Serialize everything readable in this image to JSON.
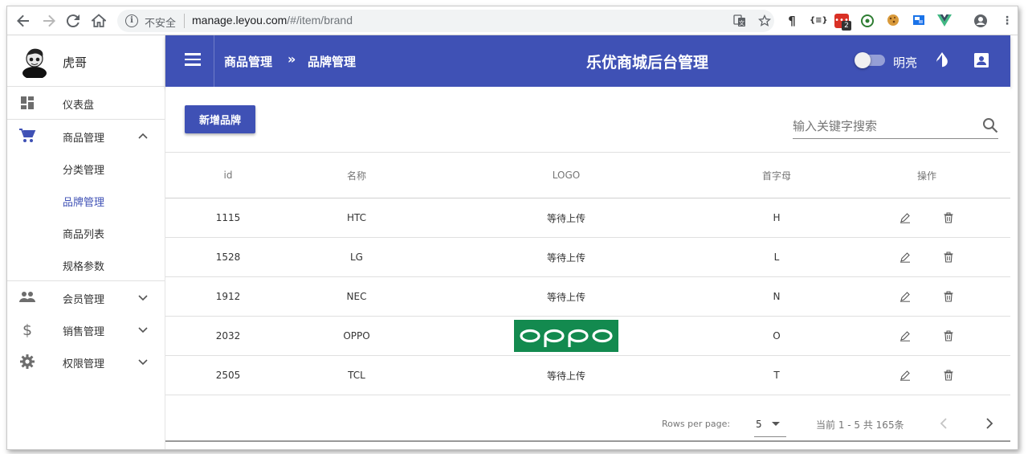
{
  "browser": {
    "insecure_label": "不安全",
    "url_host": "manage.leyou.com",
    "url_path": "/#/item/brand",
    "extension_badge": "2"
  },
  "sidebar": {
    "user_name": "虎哥",
    "items": [
      {
        "label": "仪表盘",
        "icon": "dashboard-icon"
      },
      {
        "label": "商品管理",
        "icon": "cart-icon",
        "expanded": true,
        "children": [
          {
            "label": "分类管理"
          },
          {
            "label": "品牌管理",
            "active": true
          },
          {
            "label": "商品列表"
          },
          {
            "label": "规格参数"
          }
        ]
      },
      {
        "label": "会员管理",
        "icon": "people-icon"
      },
      {
        "label": "销售管理",
        "icon": "dollar-icon"
      },
      {
        "label": "权限管理",
        "icon": "gear-icon"
      }
    ]
  },
  "header": {
    "breadcrumb_1": "商品管理",
    "breadcrumb_sep": "»",
    "breadcrumb_2": "品牌管理",
    "title": "乐优商城后台管理",
    "theme_label": "明亮",
    "accent": "#3f51b5"
  },
  "toolbar": {
    "add_label": "新增品牌",
    "search_placeholder": "输入关键字搜索"
  },
  "table": {
    "columns": [
      "id",
      "名称",
      "LOGO",
      "首字母",
      "操作"
    ],
    "rows": [
      {
        "id": "1115",
        "name": "HTC",
        "logo": "等待上传",
        "letter": "H"
      },
      {
        "id": "1528",
        "name": "LG",
        "logo": "等待上传",
        "letter": "L"
      },
      {
        "id": "1912",
        "name": "NEC",
        "logo": "等待上传",
        "letter": "N"
      },
      {
        "id": "2032",
        "name": "OPPO",
        "logo_image": "oppo-logo",
        "letter": "O"
      },
      {
        "id": "2505",
        "name": "TCL",
        "logo": "等待上传",
        "letter": "T"
      }
    ]
  },
  "pagination": {
    "rows_label": "Rows per page:",
    "rows_value": "5",
    "range_text": "当前 1 - 5 共 165条"
  }
}
